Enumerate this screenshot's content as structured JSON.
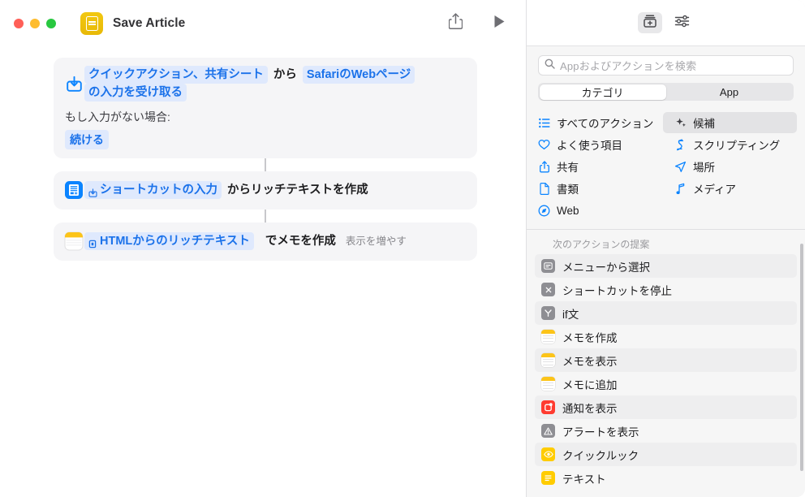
{
  "window": {
    "title": "Save Article",
    "app_icon": "shortcuts-app-icon",
    "controls": {
      "close": "close",
      "minimize": "minimize",
      "zoom": "zoom"
    },
    "toolbar": {
      "share_label": "share-icon",
      "run_label": "play-icon"
    }
  },
  "editor": {
    "actions": [
      {
        "icon": "receive-input-icon",
        "segments": [
          {
            "type": "token",
            "text": "クイックアクション、共有シート"
          },
          {
            "type": "plain",
            "text": "から"
          },
          {
            "type": "token_plain",
            "text": "SafariのWebページ"
          },
          {
            "type": "token_plain",
            "text": "の入力を受け取る"
          }
        ],
        "sub_label": "もし入力がない場合:",
        "chip": "続ける"
      },
      {
        "icon": "rich-text-document-icon",
        "segments": [
          {
            "type": "token_mini",
            "text": "ショートカットの入力",
            "mini_icon": "shortcut-input-icon"
          },
          {
            "type": "plain",
            "text": "からリッチテキストを作成"
          }
        ]
      },
      {
        "icon": "notes-app-icon",
        "segments": [
          {
            "type": "token_mini",
            "text": "HTMLからのリッチテキスト",
            "mini_icon": "variable-icon"
          },
          {
            "type": "plain",
            "text": "でメモを作成"
          }
        ],
        "show_more": "表示を増やす"
      }
    ]
  },
  "library": {
    "toolbar": {
      "action_library_icon": "action-library-icon",
      "settings_icon": "sliders-icon"
    },
    "search": {
      "placeholder": "Appおよびアクションを検索",
      "value": "",
      "icon": "search-icon"
    },
    "segmented": {
      "options": [
        "カテゴリ",
        "App"
      ],
      "selected": "カテゴリ"
    },
    "categories": [
      {
        "label": "すべてのアクション",
        "icon": "list-icon",
        "selected": false
      },
      {
        "label": "候補",
        "icon": "sparkles-icon",
        "selected": true
      },
      {
        "label": "よく使う項目",
        "icon": "heart-icon",
        "selected": false
      },
      {
        "label": "スクリプティング",
        "icon": "script-icon",
        "selected": false
      },
      {
        "label": "共有",
        "icon": "share-icon",
        "selected": false
      },
      {
        "label": "場所",
        "icon": "location-arrow-icon",
        "selected": false
      },
      {
        "label": "書類",
        "icon": "document-icon",
        "selected": false
      },
      {
        "label": "メディア",
        "icon": "music-note-icon",
        "selected": false
      },
      {
        "label": "Web",
        "icon": "compass-icon",
        "selected": false
      }
    ],
    "suggestions_header": "次のアクションの提案",
    "suggestions": [
      {
        "label": "メニューから選択",
        "icon": "menu-icon",
        "swatch": "gray"
      },
      {
        "label": "ショートカットを停止",
        "icon": "stop-x-icon",
        "swatch": "gray"
      },
      {
        "label": "if文",
        "icon": "branch-icon",
        "swatch": "gray"
      },
      {
        "label": "メモを作成",
        "icon": "notes-app-icon",
        "swatch": "notes"
      },
      {
        "label": "メモを表示",
        "icon": "notes-app-icon",
        "swatch": "notes"
      },
      {
        "label": "メモに追加",
        "icon": "notes-app-icon",
        "swatch": "notes"
      },
      {
        "label": "通知を表示",
        "icon": "notification-icon",
        "swatch": "red"
      },
      {
        "label": "アラートを表示",
        "icon": "alert-triangle-icon",
        "swatch": "gray"
      },
      {
        "label": "クイックルック",
        "icon": "eye-icon",
        "swatch": "yel"
      },
      {
        "label": "テキスト",
        "icon": "text-lines-icon",
        "swatch": "yel"
      }
    ]
  },
  "colors": {
    "accent_blue": "#1b72ea",
    "token_bg": "#dfe9fd",
    "card_bg": "#f5f5f7",
    "sidebar_bg": "#f6f6f6",
    "app_yellow": "#f2c811"
  }
}
